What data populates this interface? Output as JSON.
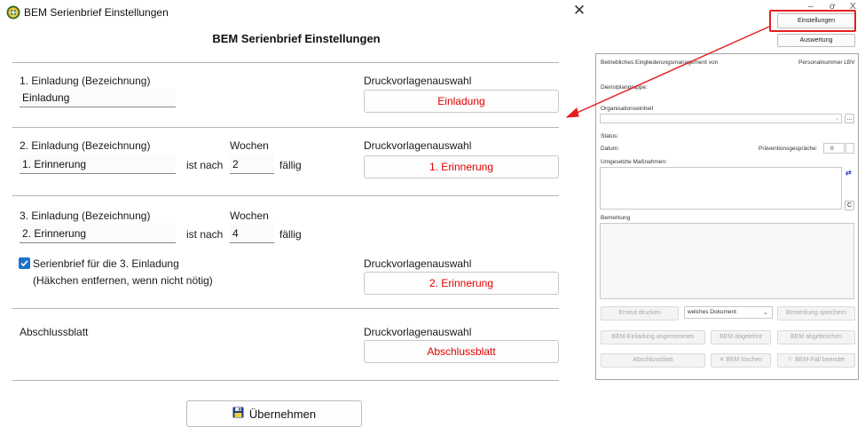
{
  "dialog": {
    "window_title": "BEM Serienbrief Einstellungen",
    "heading": "BEM Serienbrief Einstellungen",
    "close_glyph": "✕",
    "section1": {
      "label": "1. Einladung (Bezeichnung)",
      "name_value": "Einladung",
      "template_label": "Druckvorlagenauswahl",
      "template_button": "Einladung"
    },
    "section2": {
      "label": "2. Einladung (Bezeichnung)",
      "name_value": "1. Erinnerung",
      "weeks_label": "Wochen",
      "after_label": "ist nach",
      "weeks_value": "2",
      "due_label": "fällig",
      "template_label": "Druckvorlagenauswahl",
      "template_button": "1. Erinnerung"
    },
    "section3": {
      "label": "3. Einladung (Bezeichnung)",
      "name_value": "2. Erinnerung",
      "weeks_label": "Wochen",
      "after_label": "ist nach",
      "weeks_value": "4",
      "due_label": "fällig",
      "checkbox_label": "Serienbrief für die 3. Einladung",
      "checkbox_checked": true,
      "hint": "(Häkchen entfernen, wenn nicht nötig)",
      "template_label": "Druckvorlagenauswahl",
      "template_button": "2. Erinnerung"
    },
    "section4": {
      "label": "Abschlussblatt",
      "template_label": "Druckvorlagenauswahl",
      "template_button": "Abschlussblatt"
    },
    "apply_button": "Übernehmen",
    "apply_icon": "floppy-disk-icon"
  },
  "background_app": {
    "window_controls": {
      "minimize": "–",
      "maximize": "ơ",
      "close": "X"
    },
    "settings_button": "Einstellungen",
    "evaluation_button": "Auswertung",
    "header_left": "Betriebliches Eingliederungsmanagement von",
    "header_right": "Personalnummer LBV",
    "duty_group_label": "Dienstplangruppe:",
    "org_unit_label": "Organisationseinheit",
    "org_unit_button": "...",
    "status_label": "Status:",
    "date_label": "Datum:",
    "prevention_label": "Präventionsgespräche:",
    "prevention_value": "0",
    "measures_label": "Umgesetzte Maßnahmen:",
    "side_button_c": "C",
    "remark_label": "Bemerkung",
    "reprint_button": "Erneut drucken",
    "document_select": "welches Dokument",
    "save_remark_button": "Bemerkung speichern",
    "accepted_button": "BEM-Einladung angenommen",
    "rejected_button": "BEM abgelehnt",
    "aborted_button": "BEM abgebrochen",
    "final_sheet_button": "Abschlussblatt",
    "delete_button": "BEM löschen",
    "delete_icon_glyph": "✕",
    "finished_button": "BEM-Fall beendet",
    "annotation_color": "#e42020"
  }
}
